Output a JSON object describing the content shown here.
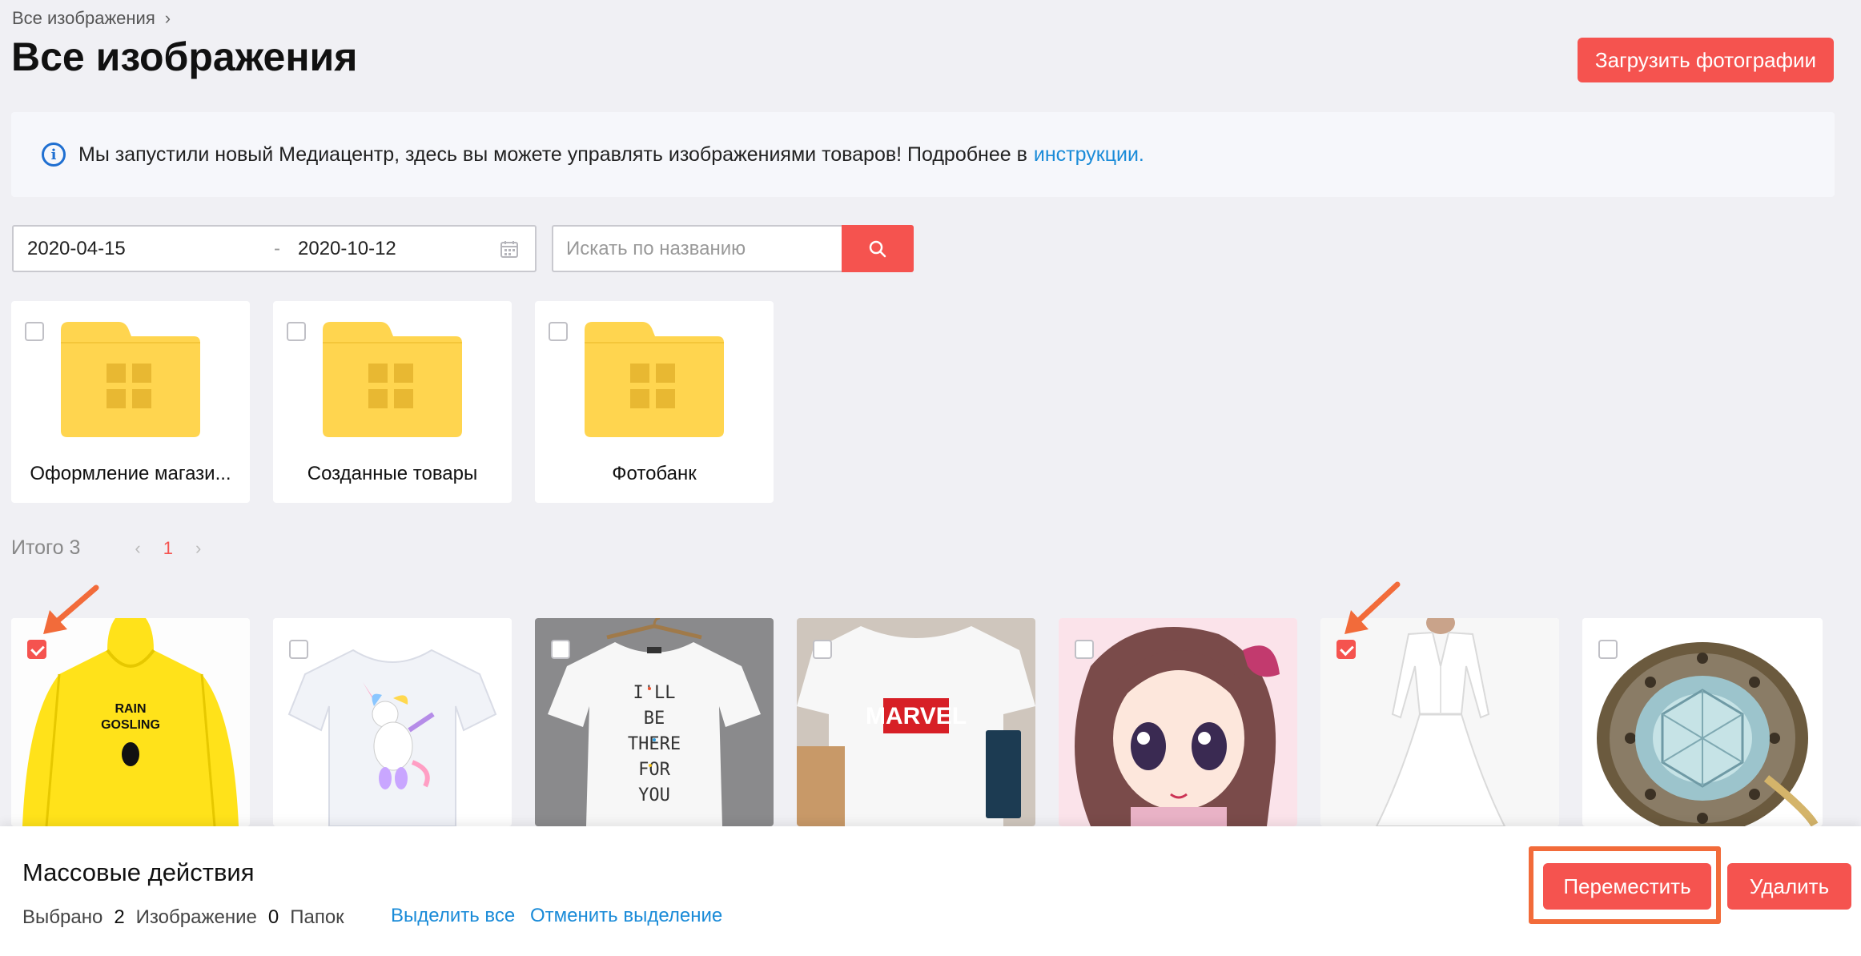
{
  "breadcrumb": {
    "item": "Все изображения",
    "separator": "›"
  },
  "page_title": "Все изображения",
  "upload_button": "Загрузить фотографии",
  "info": {
    "text": "Мы запустили новый Медиацентр, здесь вы можете управлять изображениями товаров! Подробнее в",
    "link": "инструкции."
  },
  "filters": {
    "date_from": "2020-04-15",
    "date_separator": "-",
    "date_to": "2020-10-12",
    "search_placeholder": "Искать по названию"
  },
  "folders": [
    {
      "label": "Оформление магази...",
      "checked": false
    },
    {
      "label": "Созданные товары",
      "checked": false
    },
    {
      "label": "Фотобанк",
      "checked": false
    }
  ],
  "pager": {
    "total": "Итого 3",
    "current": "1"
  },
  "images": [
    {
      "name": "yellow-raincoat",
      "checked": true,
      "text": "RAIN GOSLING"
    },
    {
      "name": "unicorn-tshirt",
      "checked": false
    },
    {
      "name": "friends-tshirt",
      "checked": false,
      "text": "I'LL BE THERE FOR YOU"
    },
    {
      "name": "marvel-tshirt",
      "checked": false,
      "text": "MARVEL"
    },
    {
      "name": "anime-girl",
      "checked": false
    },
    {
      "name": "white-dress",
      "checked": true
    },
    {
      "name": "gem-ring",
      "checked": false
    }
  ],
  "bulk": {
    "title": "Массовые действия",
    "selected_label": "Выбрано",
    "images_count": "2",
    "images_label": "Изображение",
    "folders_count": "0",
    "folders_label": "Папок",
    "select_all": "Выделить все",
    "deselect": "Отменить выделение",
    "move_button": "Переместить",
    "delete_button": "Удалить"
  },
  "colors": {
    "accent": "#f5534f",
    "link": "#1a8bd8",
    "annotation": "#f26b3a",
    "folder": "#ffd54f"
  }
}
